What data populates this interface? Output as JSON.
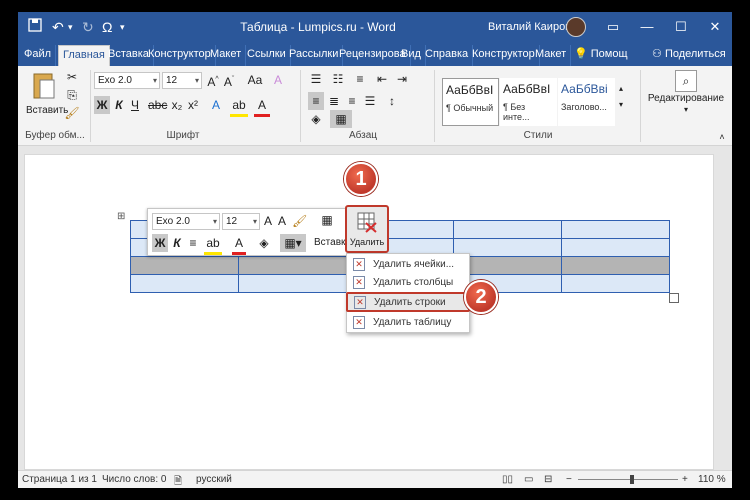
{
  "titlebar": {
    "doc_title": "Таблица - Lumpics.ru  -  Word",
    "user_name": "Виталий Каиров",
    "save_icon": "save-icon",
    "undo_icon": "undo-icon",
    "redo_icon": "redo-icon",
    "symbol_label": "Ω"
  },
  "tabs": [
    {
      "label": "Файл",
      "active": false
    },
    {
      "label": "Главная",
      "active": true
    },
    {
      "label": "Вставка",
      "active": false
    },
    {
      "label": "Конструктор",
      "active": false
    },
    {
      "label": "Макет",
      "active": false
    },
    {
      "label": "Ссылки",
      "active": false
    },
    {
      "label": "Рассылки",
      "active": false
    },
    {
      "label": "Рецензирова",
      "active": false
    },
    {
      "label": "Вид",
      "active": false
    },
    {
      "label": "Справка",
      "active": false
    },
    {
      "label": "Конструктор",
      "active": false
    },
    {
      "label": "Макет",
      "active": false
    }
  ],
  "tab_extra": {
    "help_label": "Помощ",
    "share_label": "Поделиться"
  },
  "ribbon": {
    "paste_label": "Вставить",
    "clipboard_group": "Буфер обм...",
    "font_name": "Exo 2.0",
    "font_size": "12",
    "bold": "Ж",
    "italic": "К",
    "underline": "Ч",
    "font_group": "Шрифт",
    "paragraph_group": "Абзац",
    "styles": [
      {
        "sample": "АаБбВвI",
        "name": "¶ Обычный"
      },
      {
        "sample": "АаБбВвI",
        "name": "¶ Без инте..."
      },
      {
        "sample": "АаБбВві",
        "name": "Заголово..."
      }
    ],
    "styles_group": "Стили",
    "editing_label": "Редактирование"
  },
  "mini_toolbar": {
    "font_name": "Exo 2.0",
    "font_size": "12",
    "insert_label": "Вставк",
    "delete_label": "Удалить"
  },
  "delete_menu": {
    "items": [
      {
        "label": "Удалить ячейки..."
      },
      {
        "label": "Удалить столбцы"
      },
      {
        "label": "Удалить строки"
      },
      {
        "label": "Удалить таблицу"
      }
    ]
  },
  "callouts": {
    "one": "1",
    "two": "2"
  },
  "statusbar": {
    "page": "Страница 1 из 1",
    "words": "Число слов: 0",
    "language": "русский",
    "zoom": "110 %"
  },
  "colors": {
    "accent": "#2b579a",
    "highlight": "#c0392b"
  }
}
